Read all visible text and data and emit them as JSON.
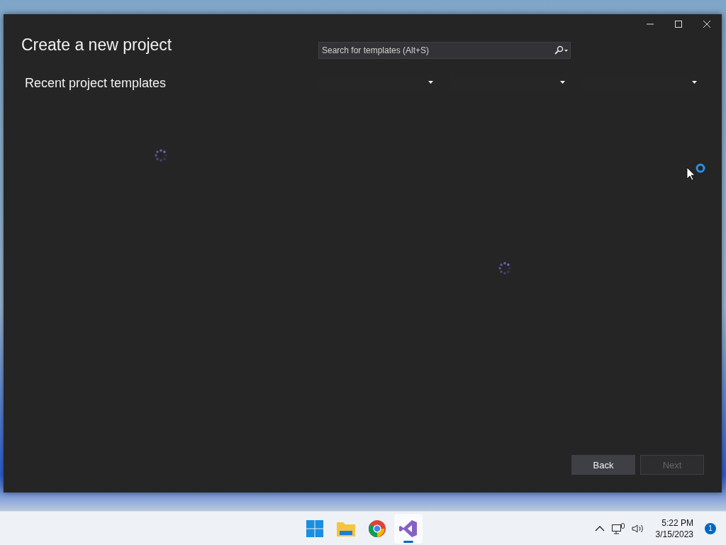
{
  "dialog": {
    "heading": "Create a new project",
    "subheading": "Recent project templates",
    "search": {
      "placeholder": "Search for templates (Alt+S)"
    },
    "buttons": [
      {
        "label": "Back",
        "disabled": false
      },
      {
        "label": "Next",
        "disabled": true
      }
    ]
  },
  "taskbar": {
    "apps": [
      {
        "kind": "start",
        "active": false
      },
      {
        "kind": "files",
        "active": false
      },
      {
        "kind": "browser",
        "active": false
      },
      {
        "kind": "ide",
        "active": true
      }
    ],
    "time": "5:22 PM",
    "date": "3/15/2023",
    "notifications": "1"
  }
}
